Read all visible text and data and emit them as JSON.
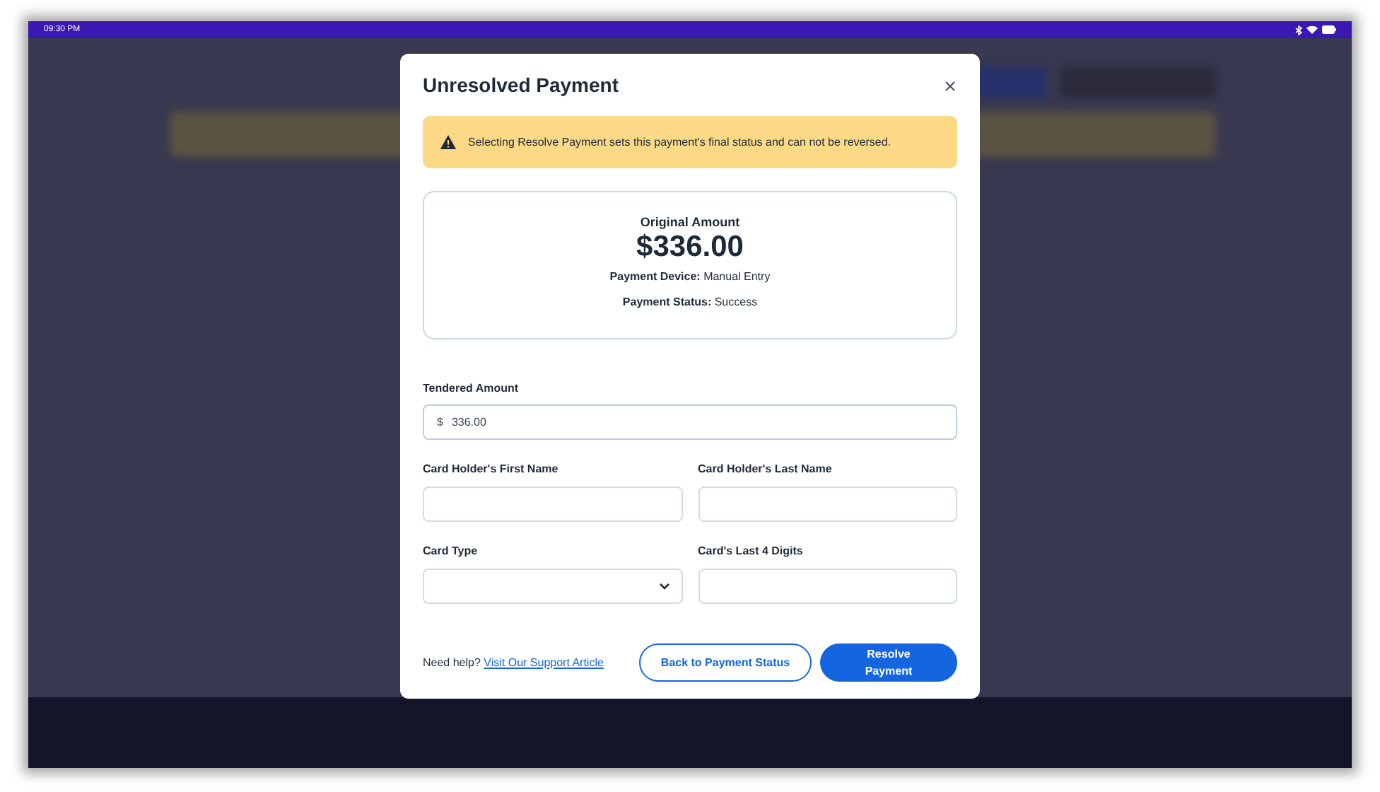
{
  "status_bar": {
    "time": "09:30 PM"
  },
  "dialog": {
    "title": "Unresolved Payment",
    "warning": "Selecting Resolve Payment sets this payment's final status and can not be reversed.",
    "summary": {
      "label": "Original Amount",
      "amount": "$336.00",
      "details": [
        {
          "label": "Payment Device:",
          "value": "Manual Entry"
        },
        {
          "label": "Payment Status:",
          "value": "Success"
        }
      ]
    },
    "tendered": {
      "label": "Tendered Amount",
      "prefix": "$",
      "value": "336.00"
    },
    "fields": [
      {
        "kind": "text",
        "label": "Card Holder's First Name"
      },
      {
        "kind": "text",
        "label": "Card Holder's Last Name"
      },
      {
        "kind": "select",
        "label": "Card Type"
      },
      {
        "kind": "text",
        "label": "Card's Last 4 Digits"
      }
    ],
    "help": {
      "text": "Need help?",
      "link": "Visit Our Support Article"
    },
    "buttons": [
      {
        "kind": "secondary",
        "label": "Back to Payment Status"
      },
      {
        "kind": "primary",
        "label": "Resolve Payment"
      }
    ]
  }
}
